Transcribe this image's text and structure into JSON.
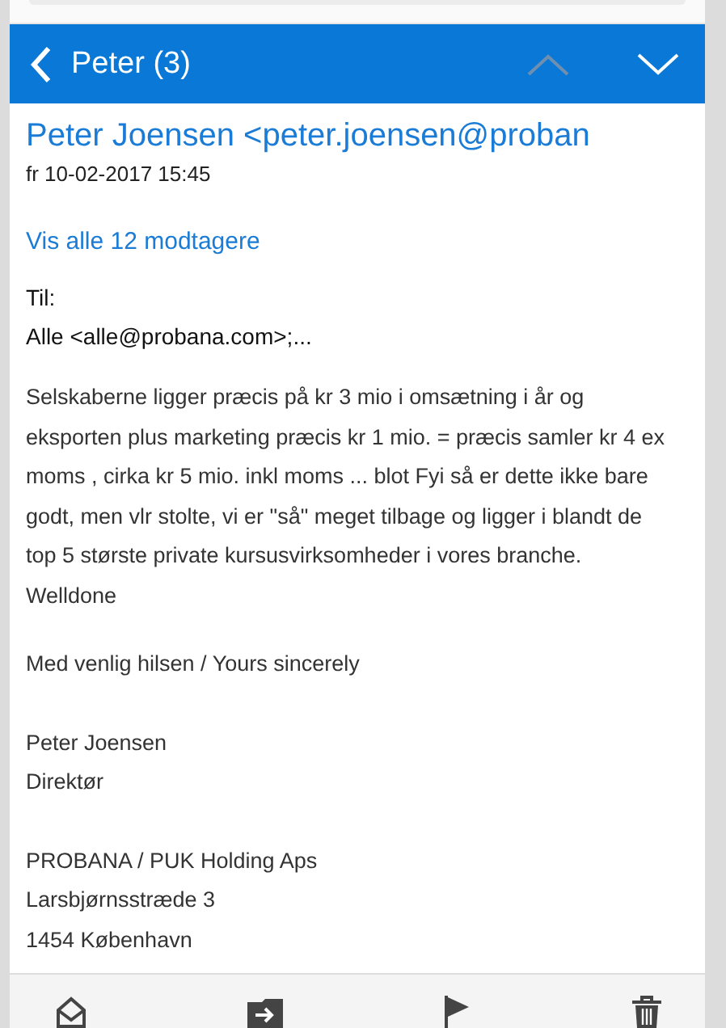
{
  "header": {
    "title": "Peter (3)",
    "nav": [
      {
        "kind": "up",
        "disabled": true
      },
      {
        "kind": "down",
        "disabled": false
      }
    ]
  },
  "message": {
    "sender": "Peter Joensen <peter.joensen@proban",
    "date": "fr 10-02-2017 15:45",
    "recipients_link": "Vis alle 12 modtagere",
    "to_label": "Til:",
    "to_value": "Alle <alle@probana.com>;...",
    "body": [
      "Selskaberne ligger præcis på kr 3 mio i omsætning i år og eksporten plus marketing præcis kr 1 mio. = præcis samler kr 4 ex moms , cirka kr 5 mio. inkl moms ... blot Fyi så er dette ikke bare godt, men vlr stolte, vi er \"så\" meget tilbage og ligger i blandt de top 5 største private kursusvirksomheder i vores branche. Welldone",
      "Med venlig hilsen / Yours sincerely"
    ],
    "signature": [
      [
        "Peter Joensen",
        "Direktør"
      ],
      [
        "PROBANA / PUK Holding Aps",
        "Larsbjørnsstræde 3",
        "1454 København"
      ]
    ]
  },
  "toolbar": [
    {
      "kind": "read"
    },
    {
      "kind": "move"
    },
    {
      "kind": "flag"
    },
    {
      "kind": "delete"
    }
  ]
}
